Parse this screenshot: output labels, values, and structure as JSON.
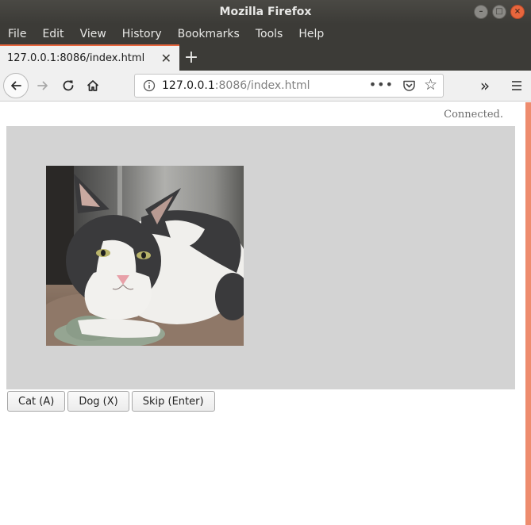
{
  "window": {
    "title": "Mozilla Firefox"
  },
  "menu": [
    "File",
    "Edit",
    "View",
    "History",
    "Bookmarks",
    "Tools",
    "Help"
  ],
  "tab": {
    "title": "127.0.0.1:8086/index.html"
  },
  "url": {
    "host": "127.0.0.1",
    "rest": ":8086/index.html"
  },
  "page": {
    "status": "Connected.",
    "buttons": {
      "cat": "Cat (A)",
      "dog": "Dog (X)",
      "skip": "Skip (Enter)"
    }
  },
  "colors": {
    "accent": "#e8663d",
    "panel": "#d3d3d3"
  }
}
